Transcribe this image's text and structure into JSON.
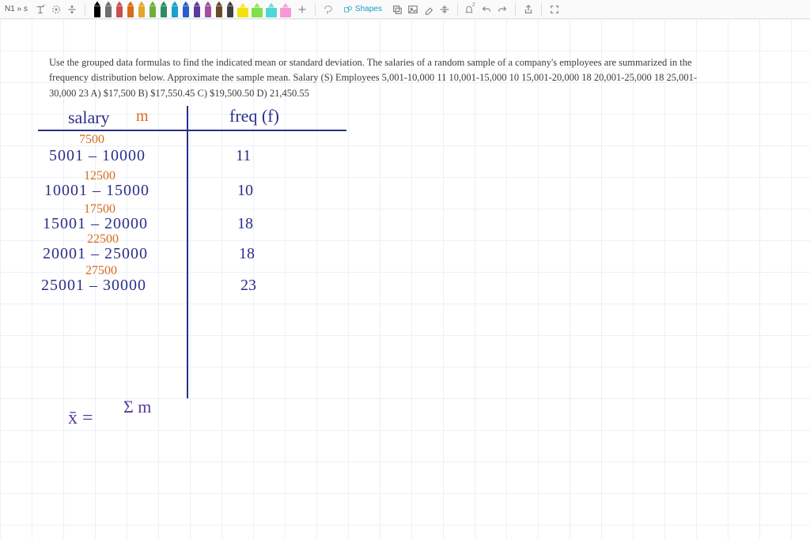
{
  "toolbar": {
    "title": "N1 » s",
    "shapes_label": "Shapes",
    "pen_colors": [
      "#000000",
      "#6e6e6e",
      "#c94f4f",
      "#d86a1a",
      "#e1a72b",
      "#6faf3c",
      "#2e8a60",
      "#18a0c8",
      "#2a5fc8",
      "#5a3b9c",
      "#a24fa0",
      "#6b4a2b",
      "#404040"
    ],
    "highlighter_colors": [
      "#f5e20a",
      "#7fe04a",
      "#4fd6d6",
      "#f59ad6"
    ]
  },
  "problem": {
    "text": "Use the grouped data formulas to find the indicated mean or standard deviation. The salaries of a random sample of a company's employees are summarized in the frequency distribution below. Approximate the sample mean. Salary (S) Employees 5,001-10,000 11 10,001-15,000 10 15,001-20,000 18 20,001-25,000 18 25,001-30,000 23 A) $17,500 B) $17,550.45 C) $19,500.50 D) 21,450.55"
  },
  "table": {
    "header_salary": "salary",
    "header_m": "m",
    "header_freq": "freq (f)",
    "rows": [
      {
        "range": "5001 – 10000",
        "mid": "7500",
        "freq": "11"
      },
      {
        "range": "10001 – 15000",
        "mid": "12500",
        "freq": "10"
      },
      {
        "range": "15001 – 20000",
        "mid": "17500",
        "freq": "18"
      },
      {
        "range": "20001 – 25000",
        "mid": "22500",
        "freq": "18"
      },
      {
        "range": "25001 – 30000",
        "mid": "27500",
        "freq": "23"
      }
    ]
  },
  "formula": {
    "lhs": "x̄ =",
    "rhs": "Σ m"
  }
}
